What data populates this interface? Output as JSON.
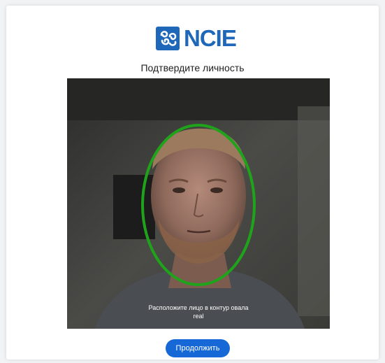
{
  "brand": {
    "logo_text": "NCIE",
    "accent": "#1f67b8"
  },
  "page": {
    "title": "Подтвердите личность"
  },
  "camera": {
    "instruction": "Расположите лицо в контур овала",
    "status": "real",
    "oval_color": "#1fa31a"
  },
  "actions": {
    "continue_label": "Продолжить",
    "button_color": "#1668d6"
  }
}
